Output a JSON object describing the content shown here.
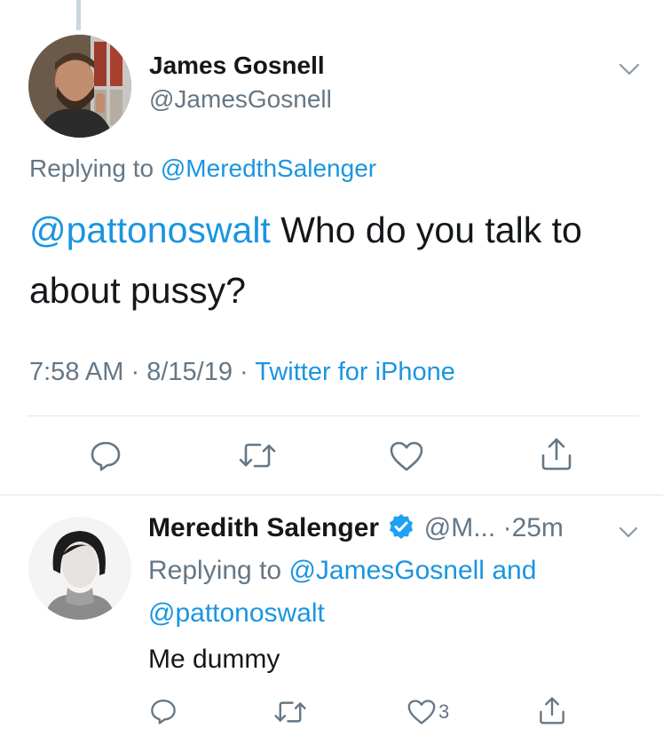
{
  "main_tweet": {
    "author_name": "James Gosnell",
    "author_handle": "@JamesGosnell",
    "replying_prefix": "Replying to",
    "replying_handle": "@MeredthSalenger",
    "text_mention": "@pattonoswalt",
    "text_line1_rest": " Who do you talk to",
    "text_line2": "about pussy?",
    "time": "7:58 AM",
    "sep": "·",
    "date": "8/15/19",
    "source": "Twitter for iPhone"
  },
  "reply_tweet": {
    "author_name": "Meredith Salenger",
    "author_handle": "@M...",
    "age": "25m",
    "sep": "·",
    "replying_prefix": "Replying to",
    "replying_handle1": "@JamesGosnell",
    "replying_and": " and",
    "replying_handle2": "@pattonoswalt",
    "text": "Me dummy",
    "like_count": "3"
  },
  "icons": {
    "reply": "reply-icon",
    "retweet": "retweet-icon",
    "like": "heart-icon",
    "share": "share-icon",
    "caret": "chevron-down-icon",
    "verified": "verified-badge-icon"
  },
  "colors": {
    "link": "#1b95e0",
    "muted": "#657786",
    "text": "#14171a",
    "verified": "#1da1f2",
    "divider": "#e1e8ed"
  }
}
